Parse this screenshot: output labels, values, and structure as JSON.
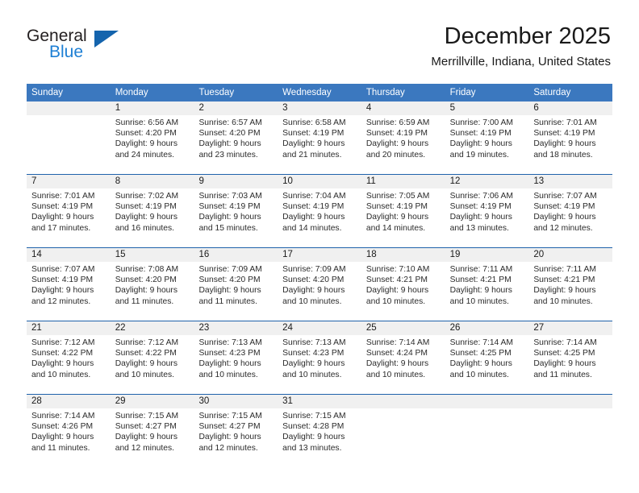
{
  "brand": {
    "word_one": "General",
    "word_two": "Blue",
    "triangle_color": "#1464ad",
    "blue_color": "#1d7fd4"
  },
  "header": {
    "title": "December 2025",
    "subtitle": "Merrillville, Indiana, United States"
  },
  "theme": {
    "header_row_bg": "#3b78bf",
    "week_divider": "#1f62ab",
    "daynum_band_bg": "#f0f0f0"
  },
  "calendar": {
    "weekdays": [
      "Sunday",
      "Monday",
      "Tuesday",
      "Wednesday",
      "Thursday",
      "Friday",
      "Saturday"
    ],
    "weeks": [
      [
        {
          "day": "",
          "lines": []
        },
        {
          "day": "1",
          "lines": [
            "Sunrise: 6:56 AM",
            "Sunset: 4:20 PM",
            "Daylight: 9 hours",
            "and 24 minutes."
          ]
        },
        {
          "day": "2",
          "lines": [
            "Sunrise: 6:57 AM",
            "Sunset: 4:20 PM",
            "Daylight: 9 hours",
            "and 23 minutes."
          ]
        },
        {
          "day": "3",
          "lines": [
            "Sunrise: 6:58 AM",
            "Sunset: 4:19 PM",
            "Daylight: 9 hours",
            "and 21 minutes."
          ]
        },
        {
          "day": "4",
          "lines": [
            "Sunrise: 6:59 AM",
            "Sunset: 4:19 PM",
            "Daylight: 9 hours",
            "and 20 minutes."
          ]
        },
        {
          "day": "5",
          "lines": [
            "Sunrise: 7:00 AM",
            "Sunset: 4:19 PM",
            "Daylight: 9 hours",
            "and 19 minutes."
          ]
        },
        {
          "day": "6",
          "lines": [
            "Sunrise: 7:01 AM",
            "Sunset: 4:19 PM",
            "Daylight: 9 hours",
            "and 18 minutes."
          ]
        }
      ],
      [
        {
          "day": "7",
          "lines": [
            "Sunrise: 7:01 AM",
            "Sunset: 4:19 PM",
            "Daylight: 9 hours",
            "and 17 minutes."
          ]
        },
        {
          "day": "8",
          "lines": [
            "Sunrise: 7:02 AM",
            "Sunset: 4:19 PM",
            "Daylight: 9 hours",
            "and 16 minutes."
          ]
        },
        {
          "day": "9",
          "lines": [
            "Sunrise: 7:03 AM",
            "Sunset: 4:19 PM",
            "Daylight: 9 hours",
            "and 15 minutes."
          ]
        },
        {
          "day": "10",
          "lines": [
            "Sunrise: 7:04 AM",
            "Sunset: 4:19 PM",
            "Daylight: 9 hours",
            "and 14 minutes."
          ]
        },
        {
          "day": "11",
          "lines": [
            "Sunrise: 7:05 AM",
            "Sunset: 4:19 PM",
            "Daylight: 9 hours",
            "and 14 minutes."
          ]
        },
        {
          "day": "12",
          "lines": [
            "Sunrise: 7:06 AM",
            "Sunset: 4:19 PM",
            "Daylight: 9 hours",
            "and 13 minutes."
          ]
        },
        {
          "day": "13",
          "lines": [
            "Sunrise: 7:07 AM",
            "Sunset: 4:19 PM",
            "Daylight: 9 hours",
            "and 12 minutes."
          ]
        }
      ],
      [
        {
          "day": "14",
          "lines": [
            "Sunrise: 7:07 AM",
            "Sunset: 4:19 PM",
            "Daylight: 9 hours",
            "and 12 minutes."
          ]
        },
        {
          "day": "15",
          "lines": [
            "Sunrise: 7:08 AM",
            "Sunset: 4:20 PM",
            "Daylight: 9 hours",
            "and 11 minutes."
          ]
        },
        {
          "day": "16",
          "lines": [
            "Sunrise: 7:09 AM",
            "Sunset: 4:20 PM",
            "Daylight: 9 hours",
            "and 11 minutes."
          ]
        },
        {
          "day": "17",
          "lines": [
            "Sunrise: 7:09 AM",
            "Sunset: 4:20 PM",
            "Daylight: 9 hours",
            "and 10 minutes."
          ]
        },
        {
          "day": "18",
          "lines": [
            "Sunrise: 7:10 AM",
            "Sunset: 4:21 PM",
            "Daylight: 9 hours",
            "and 10 minutes."
          ]
        },
        {
          "day": "19",
          "lines": [
            "Sunrise: 7:11 AM",
            "Sunset: 4:21 PM",
            "Daylight: 9 hours",
            "and 10 minutes."
          ]
        },
        {
          "day": "20",
          "lines": [
            "Sunrise: 7:11 AM",
            "Sunset: 4:21 PM",
            "Daylight: 9 hours",
            "and 10 minutes."
          ]
        }
      ],
      [
        {
          "day": "21",
          "lines": [
            "Sunrise: 7:12 AM",
            "Sunset: 4:22 PM",
            "Daylight: 9 hours",
            "and 10 minutes."
          ]
        },
        {
          "day": "22",
          "lines": [
            "Sunrise: 7:12 AM",
            "Sunset: 4:22 PM",
            "Daylight: 9 hours",
            "and 10 minutes."
          ]
        },
        {
          "day": "23",
          "lines": [
            "Sunrise: 7:13 AM",
            "Sunset: 4:23 PM",
            "Daylight: 9 hours",
            "and 10 minutes."
          ]
        },
        {
          "day": "24",
          "lines": [
            "Sunrise: 7:13 AM",
            "Sunset: 4:23 PM",
            "Daylight: 9 hours",
            "and 10 minutes."
          ]
        },
        {
          "day": "25",
          "lines": [
            "Sunrise: 7:14 AM",
            "Sunset: 4:24 PM",
            "Daylight: 9 hours",
            "and 10 minutes."
          ]
        },
        {
          "day": "26",
          "lines": [
            "Sunrise: 7:14 AM",
            "Sunset: 4:25 PM",
            "Daylight: 9 hours",
            "and 10 minutes."
          ]
        },
        {
          "day": "27",
          "lines": [
            "Sunrise: 7:14 AM",
            "Sunset: 4:25 PM",
            "Daylight: 9 hours",
            "and 11 minutes."
          ]
        }
      ],
      [
        {
          "day": "28",
          "lines": [
            "Sunrise: 7:14 AM",
            "Sunset: 4:26 PM",
            "Daylight: 9 hours",
            "and 11 minutes."
          ]
        },
        {
          "day": "29",
          "lines": [
            "Sunrise: 7:15 AM",
            "Sunset: 4:27 PM",
            "Daylight: 9 hours",
            "and 12 minutes."
          ]
        },
        {
          "day": "30",
          "lines": [
            "Sunrise: 7:15 AM",
            "Sunset: 4:27 PM",
            "Daylight: 9 hours",
            "and 12 minutes."
          ]
        },
        {
          "day": "31",
          "lines": [
            "Sunrise: 7:15 AM",
            "Sunset: 4:28 PM",
            "Daylight: 9 hours",
            "and 13 minutes."
          ]
        },
        {
          "day": "",
          "lines": []
        },
        {
          "day": "",
          "lines": []
        },
        {
          "day": "",
          "lines": []
        }
      ]
    ]
  }
}
